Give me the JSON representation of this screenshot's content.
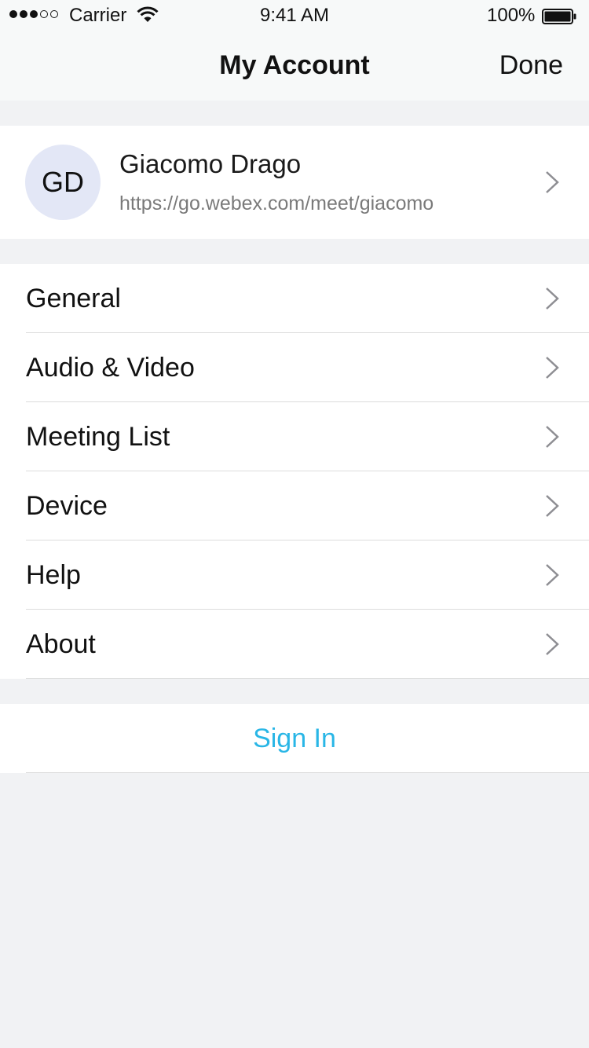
{
  "status_bar": {
    "signal_bars_filled": 3,
    "signal_bars_total": 5,
    "carrier": "Carrier",
    "time": "9:41 AM",
    "battery_percent": "100%",
    "icons": [
      "signal-dots-icon",
      "wifi-icon",
      "battery-icon"
    ]
  },
  "nav": {
    "title": "My Account",
    "done_label": "Done"
  },
  "profile": {
    "initials": "GD",
    "name": "Giacomo Drago",
    "url": "https://go.webex.com/meet/giacomo",
    "avatar_bg": "#e3e7f6"
  },
  "menu": {
    "items": [
      {
        "label": "General"
      },
      {
        "label": "Audio & Video"
      },
      {
        "label": "Meeting List"
      },
      {
        "label": "Device"
      },
      {
        "label": "Help"
      },
      {
        "label": "About"
      }
    ]
  },
  "sign_in": {
    "label": "Sign In",
    "color": "#29b6e6"
  },
  "colors": {
    "background": "#f1f2f4",
    "nav_background": "#f7f9f9",
    "accent": "#29b6e6",
    "chevron": "#8e8e93"
  }
}
